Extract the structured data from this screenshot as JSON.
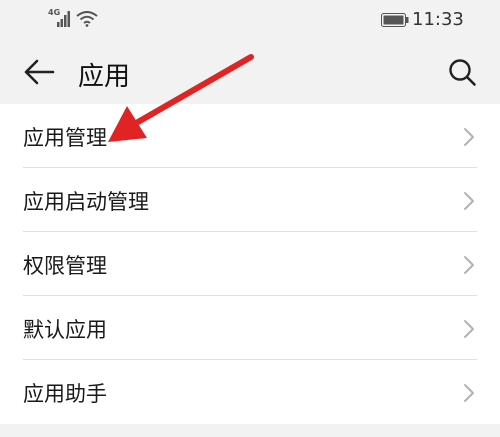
{
  "status_bar": {
    "network": "4G",
    "time": "11:33"
  },
  "header": {
    "title": "应用",
    "back_icon": "arrow-left-icon",
    "search_icon": "search-icon"
  },
  "menu": {
    "items": [
      {
        "label": "应用管理"
      },
      {
        "label": "应用启动管理"
      },
      {
        "label": "权限管理"
      },
      {
        "label": "默认应用"
      },
      {
        "label": "应用助手"
      }
    ]
  },
  "annotation": {
    "color": "#e02424",
    "target": "应用管理"
  }
}
